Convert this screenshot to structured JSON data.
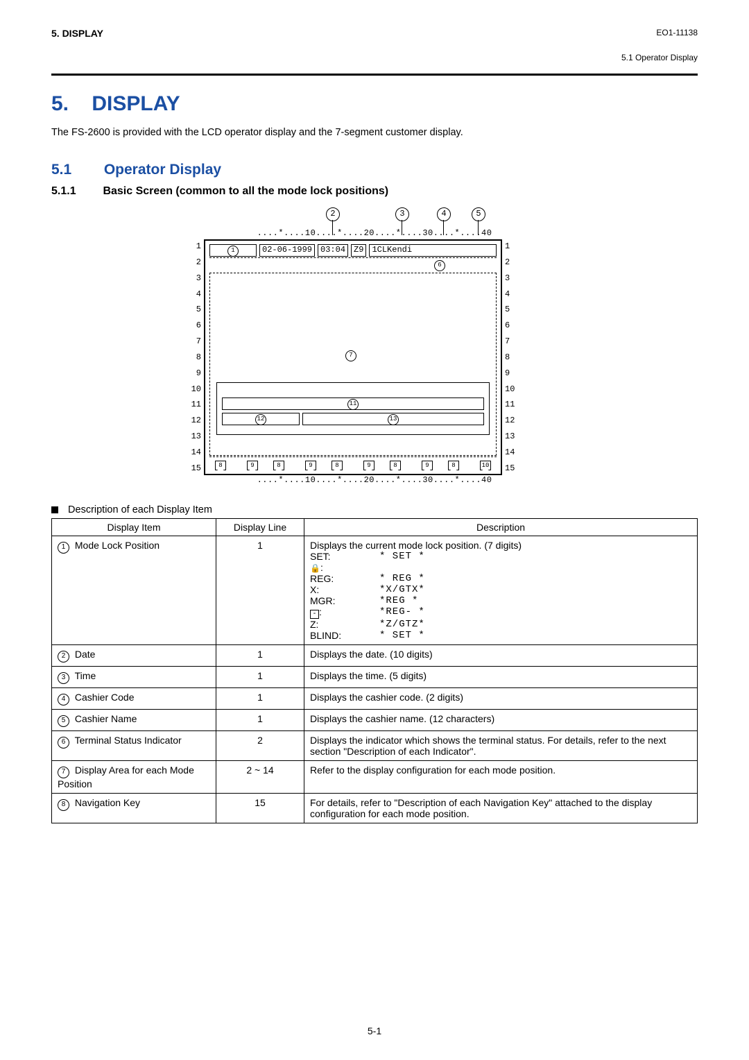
{
  "header": {
    "left": "5.   DISPLAY",
    "doc_id": "EO1-11138",
    "breadcrumb": "5.1  Operator Display"
  },
  "chapter": {
    "number": "5.",
    "title": "DISPLAY"
  },
  "intro": "The FS-2600 is provided with the LCD operator display and the 7-segment customer display.",
  "section": {
    "number": "5.1",
    "title": "Operator Display"
  },
  "subsection": {
    "number": "5.1.1",
    "title": "Basic Screen (common to all the mode lock positions)"
  },
  "diagram": {
    "top_callouts": [
      "2",
      "3",
      "4",
      "5"
    ],
    "ruler_chunks": [
      "....*....",
      "10",
      "....*....",
      "20",
      "....*....",
      "30",
      "....*....",
      "40"
    ],
    "row_numbers_left": [
      "1",
      "2",
      "3",
      "4",
      "5",
      "6",
      "7",
      "8",
      "9",
      "10",
      "11",
      "12",
      "13",
      "14",
      "15"
    ],
    "row_numbers_right": [
      "1",
      "2",
      "3",
      "4",
      "5",
      "6",
      "7",
      "8",
      "9",
      "10",
      "11",
      "12",
      "13",
      "14",
      "15"
    ],
    "line1": {
      "mark1": "1",
      "date": "02-06-1999",
      "time": "03:04",
      "cashier_code": "Z9",
      "cashier_name": "1CLKendi"
    },
    "markers": {
      "m6": "6",
      "m7": "7",
      "m11": "11",
      "m12": "12",
      "m13": "13",
      "bottom_row": [
        "8",
        "9",
        "8",
        "9",
        "8",
        "9",
        "8",
        "9",
        "8",
        "10"
      ]
    }
  },
  "desc_lead": "Description of each Display Item",
  "table": {
    "headers": [
      "Display Item",
      "Display Line",
      "Description"
    ],
    "rows": [
      {
        "num": "1",
        "item": "Mode Lock Position",
        "line": "1",
        "desc_text": "Displays the current mode lock position. (7 digits)",
        "modes": [
          {
            "label": "SET:",
            "value": "* SET *"
          },
          {
            "label": "lock",
            "value": ""
          },
          {
            "label": "REG:",
            "value": "* REG *"
          },
          {
            "label": "X:",
            "value": "*X/GTX*"
          },
          {
            "label": "MGR:",
            "value": "*REG *"
          },
          {
            "label": "minus",
            "value": "*REG- *"
          },
          {
            "label": "Z:",
            "value": "*Z/GTZ*"
          },
          {
            "label": "BLIND:",
            "value": "* SET *"
          }
        ]
      },
      {
        "num": "2",
        "item": "Date",
        "line": "1",
        "desc_text": "Displays the date. (10 digits)"
      },
      {
        "num": "3",
        "item": "Time",
        "line": "1",
        "desc_text": "Displays the time. (5 digits)"
      },
      {
        "num": "4",
        "item": "Cashier Code",
        "line": "1",
        "desc_text": "Displays the cashier code. (2 digits)"
      },
      {
        "num": "5",
        "item": "Cashier Name",
        "line": "1",
        "desc_text": "Displays the cashier name. (12 characters)"
      },
      {
        "num": "6",
        "item": "Terminal Status Indicator",
        "line": "2",
        "desc_text": "Displays the indicator which shows the terminal status. For details, refer to the next section \"Description of each Indicator\"."
      },
      {
        "num": "7",
        "item": "Display Area for each Mode Position",
        "line": "2 ~ 14",
        "desc_text": "Refer to the display configuration for each mode position."
      },
      {
        "num": "8",
        "item": "Navigation Key",
        "line": "15",
        "desc_text": "For details, refer to \"Description of each Navigation Key\" attached to the display configuration for each mode position."
      }
    ]
  },
  "footer": "5-1"
}
